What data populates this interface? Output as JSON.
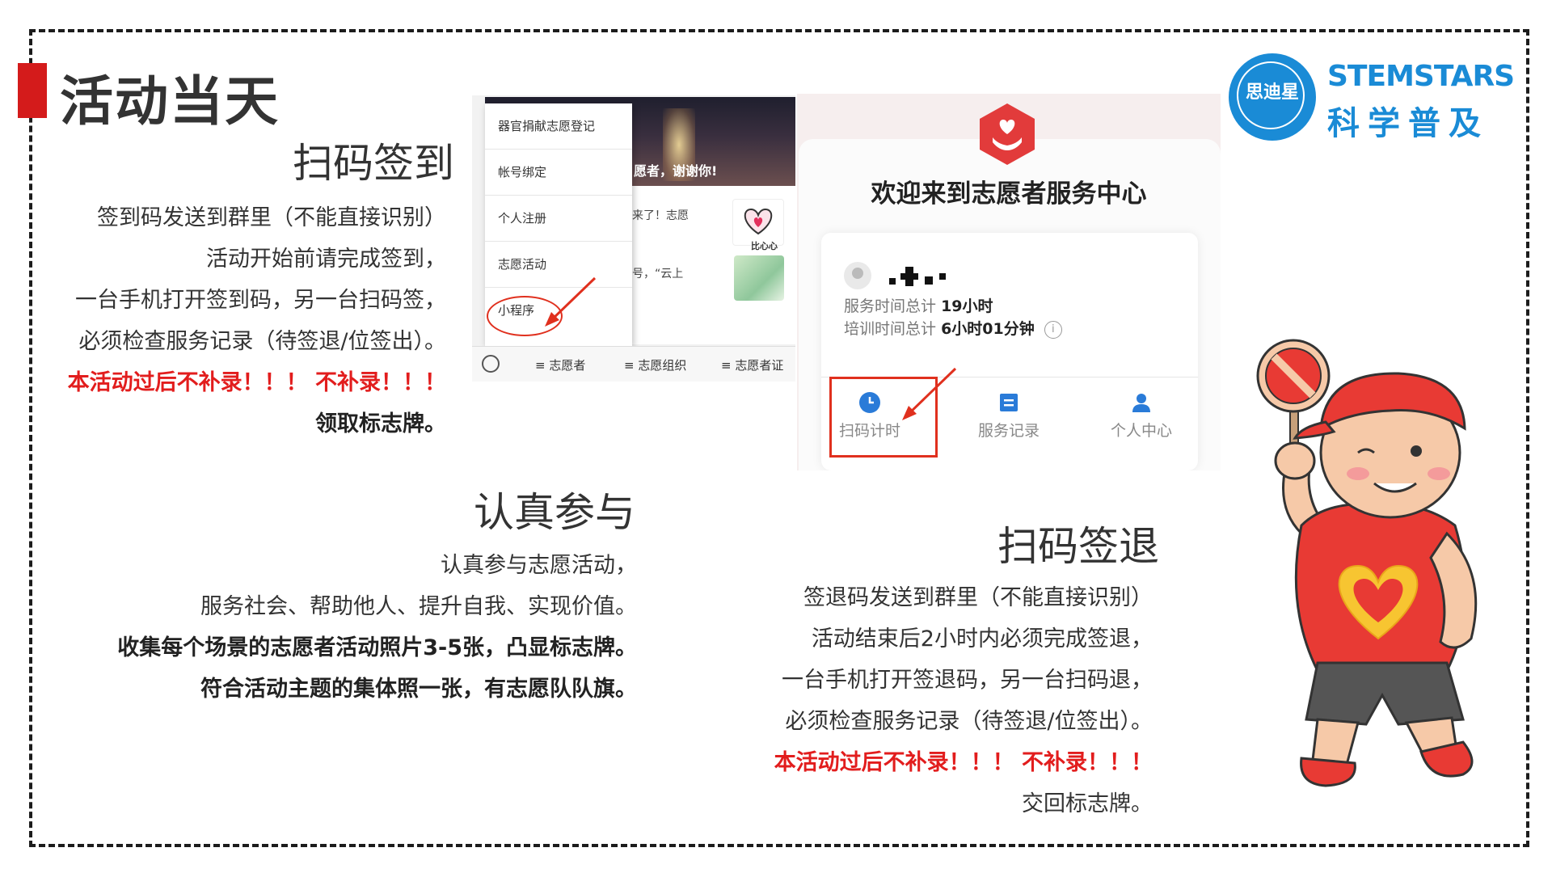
{
  "page": {
    "title": "活动当天"
  },
  "brand": {
    "name_en": "STEMSTARS",
    "name_cn": "科学普及",
    "circle_text": "思迪星"
  },
  "sections": {
    "checkin": {
      "heading": "扫码签到",
      "lines": [
        {
          "text": "签到码发送到群里（不能直接识别）",
          "style": "normal"
        },
        {
          "text": "活动开始前请完成签到，",
          "style": "normal"
        },
        {
          "text": "一台手机打开签到码，另一台扫码签，",
          "style": "normal"
        },
        {
          "text": "必须检查服务记录（待签退/位签出）。",
          "style": "normal"
        },
        {
          "text": "本活动过后不补录！！！ 不补录！！！",
          "style": "red"
        },
        {
          "text": "领取标志牌。",
          "style": "bold"
        }
      ]
    },
    "participate": {
      "heading": "认真参与",
      "lines": [
        {
          "text": "认真参与志愿活动，",
          "style": "normal"
        },
        {
          "text": "服务社会、帮助他人、提升自我、实现价值。",
          "style": "normal"
        },
        {
          "text": "收集每个场景的志愿者活动照片3-5张，凸显标志牌。",
          "style": "bold"
        },
        {
          "text": "符合活动主题的集体照一张，有志愿队队旗。",
          "style": "bold"
        }
      ]
    },
    "checkout": {
      "heading": "扫码签退",
      "lines": [
        {
          "text": "签退码发送到群里（不能直接识别）",
          "style": "normal"
        },
        {
          "text": "活动结束后2小时内必须完成签退，",
          "style": "normal"
        },
        {
          "text": "一台手机打开签退码，另一台扫码退，",
          "style": "normal"
        },
        {
          "text": "必须检查服务记录（待签退/位签出）。",
          "style": "normal"
        },
        {
          "text": "本活动过后不补录！！！ 不补录！！！",
          "style": "red"
        },
        {
          "text": "交回标志牌。",
          "style": "normal"
        }
      ]
    }
  },
  "screenshot_wechat": {
    "menu_items": [
      "器官捐献志愿登记",
      "帐号绑定",
      "个人注册",
      "志愿活动",
      "小程序"
    ],
    "photo_caption": "愿者，谢谢你!",
    "feed_rows": [
      "福利来了！志愿",
      "集结号，“云上"
    ],
    "thumb_label": "比心心",
    "tabs": [
      "≡ 志愿者",
      "≡ 志愿组织",
      "≡ 志愿者证"
    ],
    "colors": {
      "highlight": "#e0301e"
    }
  },
  "screenshot_center": {
    "welcome": "欢迎来到志愿者服务中心",
    "service_label": "服务时间总计",
    "service_value": "19小时",
    "training_label": "培训时间总计",
    "training_value": "6小时01分钟",
    "info_glyph": "i",
    "nav": [
      {
        "label": "扫码计时",
        "icon": "clock-icon"
      },
      {
        "label": "服务记录",
        "icon": "record-icon"
      },
      {
        "label": "个人中心",
        "icon": "user-icon"
      }
    ],
    "colors": {
      "accent": "#2a7bd8",
      "logo": "#e23b3b"
    }
  }
}
